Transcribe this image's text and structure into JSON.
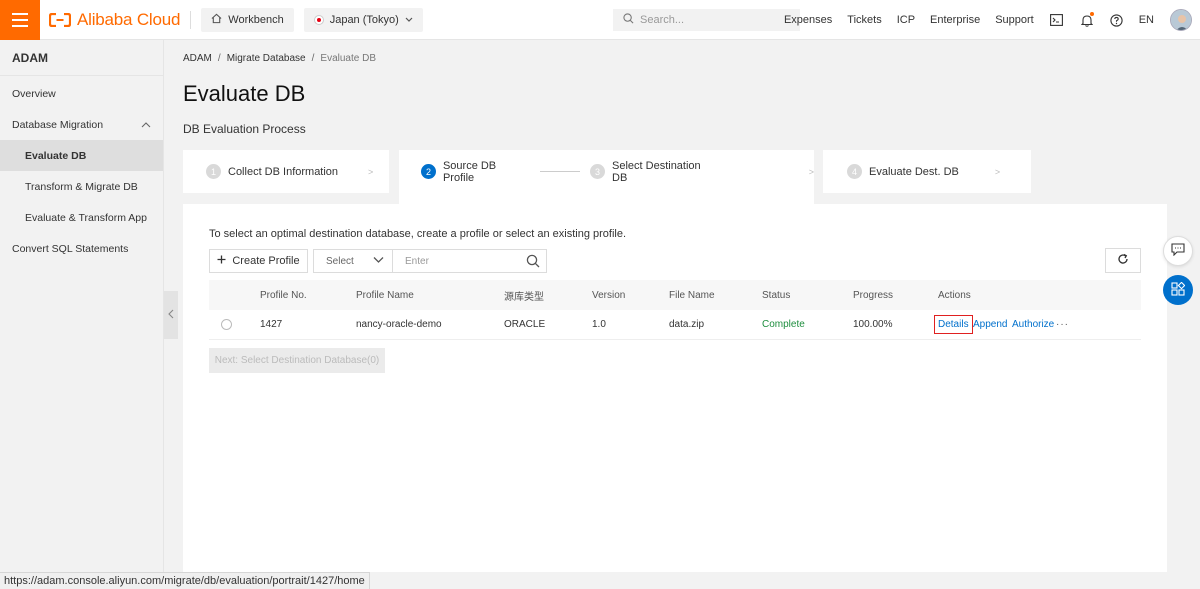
{
  "header": {
    "brand": "Alibaba Cloud",
    "workbench": "Workbench",
    "region": "Japan (Tokyo)",
    "search_placeholder": "Search...",
    "nav": [
      "Expenses",
      "Tickets",
      "ICP",
      "Enterprise",
      "Support"
    ],
    "lang": "EN",
    "colors": {
      "brand": "#ff6a00",
      "accent": "#0070cc"
    }
  },
  "sidebar": {
    "title": "ADAM",
    "items": [
      {
        "label": "Overview"
      },
      {
        "label": "Database Migration"
      },
      {
        "label": "Evaluate DB"
      },
      {
        "label": "Transform & Migrate DB"
      },
      {
        "label": "Evaluate & Transform App"
      },
      {
        "label": "Convert SQL Statements"
      }
    ]
  },
  "breadcrumb": [
    "ADAM",
    "Migrate Database",
    "Evaluate DB"
  ],
  "page": {
    "title": "Evaluate DB",
    "process_label": "DB Evaluation Process"
  },
  "steps": [
    {
      "num": "1",
      "label": "Collect DB Information"
    },
    {
      "num": "2",
      "label": "Source DB Profile"
    },
    {
      "num": "3",
      "label": "Select Destination DB"
    },
    {
      "num": "4",
      "label": "Evaluate Dest. DB"
    }
  ],
  "profile": {
    "hint": "To select an optimal destination database, create a profile or select an existing profile.",
    "create_label": "Create Profile",
    "select_placeholder": "Select",
    "filter_placeholder": "Enter",
    "columns": [
      "Profile No.",
      "Profile Name",
      "源库类型",
      "Version",
      "File Name",
      "Status",
      "Progress",
      "Actions"
    ],
    "rows": [
      {
        "profile_no": "1427",
        "profile_name": "nancy-oracle-demo",
        "source_type": "ORACLE",
        "version": "1.0",
        "file_name": "data.zip",
        "status": "Complete",
        "progress": "100.00%",
        "actions": [
          "Details",
          "Append",
          "Authorize",
          "···"
        ]
      }
    ],
    "next_label": "Next: Select Destination Database(0)"
  },
  "statusbar": {
    "url": "https://adam.console.aliyun.com/migrate/db/evaluation/portrait/1427/home"
  }
}
